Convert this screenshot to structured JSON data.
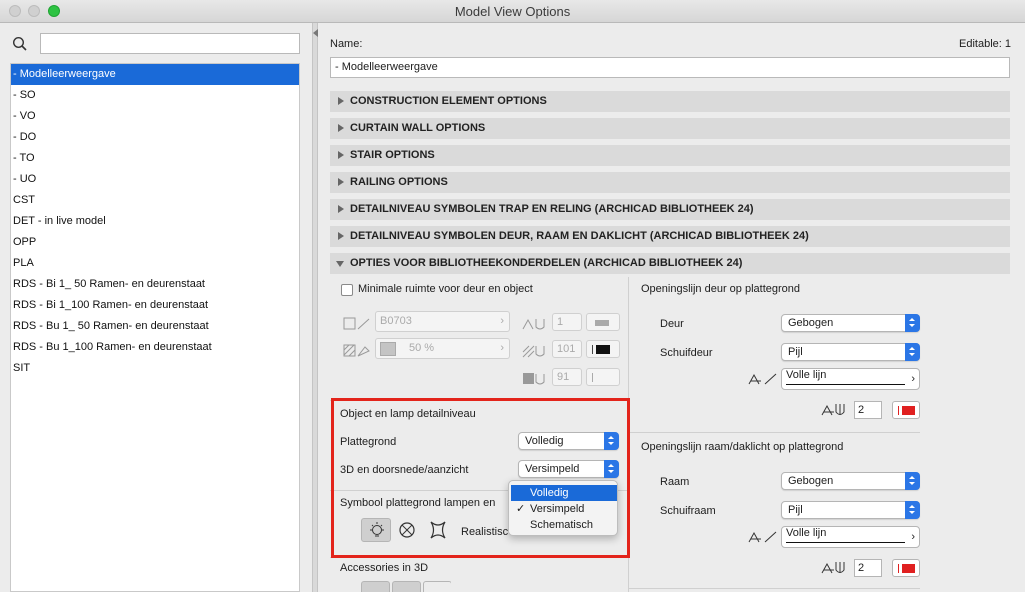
{
  "window": {
    "title": "Model View Options"
  },
  "sidebar": {
    "search_value": "",
    "items": [
      "-  Modelleerweergave",
      "-  SO",
      "-  VO",
      "- DO",
      "- TO",
      "- UO",
      "CST",
      "DET - in live model",
      "OPP",
      "PLA",
      "RDS - Bi 1_ 50 Ramen- en deurenstaat",
      "RDS - Bi 1_100 Ramen- en deurenstaat",
      "RDS - Bu 1_ 50 Ramen- en deurenstaat",
      "RDS - Bu 1_100 Ramen- en deurenstaat",
      "SIT"
    ]
  },
  "main": {
    "name_label": "Name:",
    "editable_label": "Editable: 1",
    "name_value": "-  Modelleerweergave",
    "sections": [
      "CONSTRUCTION ELEMENT OPTIONS",
      "CURTAIN WALL OPTIONS",
      "STAIR OPTIONS",
      "RAILING OPTIONS",
      "DETAILNIVEAU SYMBOLEN TRAP EN RELING (ARCHICAD BIBLIOTHEEK 24)",
      "DETAILNIVEAU SYMBOLEN DEUR, RAAM EN DAKLICHT (ARCHICAD BIBLIOTHEEK 24)",
      "OPTIES VOOR BIBLIOTHEEKONDERDELEN (ARCHICAD BIBLIOTHEEK 24)"
    ],
    "left": {
      "min_space_label": "Minimale ruimte voor deur en object",
      "fill_name": "B0703",
      "fill_percent": "50 %",
      "pen1": "1",
      "pen2": "101",
      "pen3": "91",
      "detail_heading": "Object en lamp detailniveau",
      "plattegrond_label": "Plattegrond",
      "plattegrond_value": "Volledig",
      "d3_label": "3D en doorsnede/aanzicht",
      "d3_value": "Versimpeld",
      "symbol_label": "Symbool plattegrond lampen en",
      "realistic_label": "Realistisc",
      "accessories_label": "Accessories in 3D",
      "dropdown_options": [
        "Volledig",
        "Versimpeld",
        "Schematisch"
      ],
      "dropdown_check": "✓"
    },
    "right": {
      "door_heading": "Openingslijn deur op plattegrond",
      "door_label": "Deur",
      "door_value": "Gebogen",
      "sliding_door_label": "Schuifdeur",
      "sliding_door_value": "Pijl",
      "line1_value": "Volle lijn",
      "pen_a": "2",
      "window_heading": "Openingslijn raam/daklicht op plattegrond",
      "window_label": "Raam",
      "window_value": "Gebogen",
      "sliding_window_label": "Schuifraam",
      "sliding_window_value": "Pijl",
      "line2_value": "Volle lijn",
      "pen_b": "2"
    }
  },
  "colors": {
    "accent": "#1a6ad8",
    "highlight": "#e3241b",
    "pen_red": "#e02020"
  }
}
